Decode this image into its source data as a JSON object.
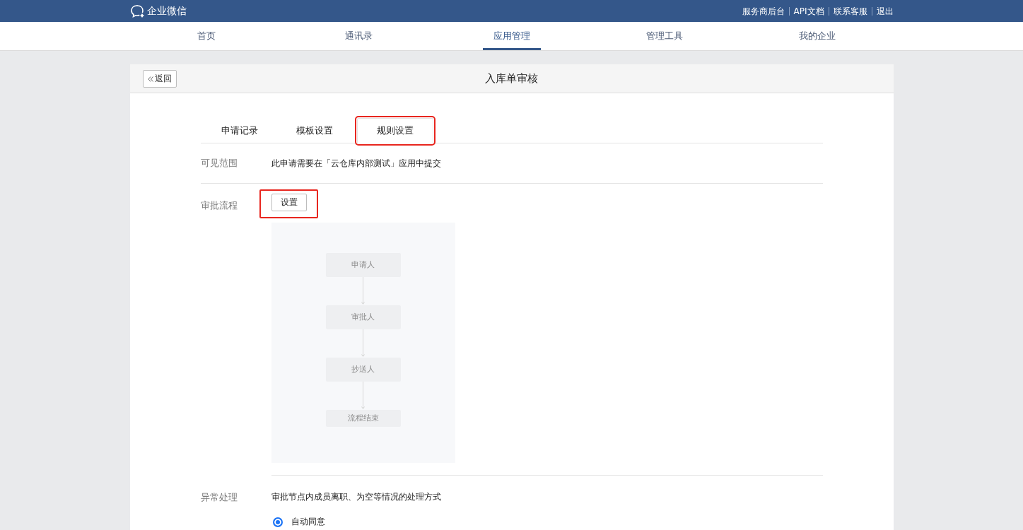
{
  "header": {
    "logo_text": "企业微信",
    "links": [
      "服务商后台",
      "API文档",
      "联系客服",
      "退出"
    ]
  },
  "nav": [
    {
      "label": "首页",
      "selected": false
    },
    {
      "label": "通讯录",
      "selected": false
    },
    {
      "label": "应用管理",
      "selected": true
    },
    {
      "label": "管理工具",
      "selected": false
    },
    {
      "label": "我的企业",
      "selected": false
    }
  ],
  "page": {
    "back_button": "返回",
    "title": "入库单审核"
  },
  "tabs": [
    {
      "label": "申请记录",
      "selected": false,
      "highlighted": false
    },
    {
      "label": "模板设置",
      "selected": false,
      "highlighted": false
    },
    {
      "label": "规则设置",
      "selected": true,
      "highlighted": true
    }
  ],
  "visibility": {
    "label": "可见范围",
    "text": "此申请需要在「云仓库内部测试」应用中提交"
  },
  "approval_flow": {
    "label": "审批流程",
    "button": {
      "label": "设置",
      "highlighted": true
    },
    "nodes": [
      "申请人",
      "审批人",
      "抄送人",
      "流程结束"
    ]
  },
  "exception_handling": {
    "label": "异常处理",
    "description": "审批节点内成员离职、为空等情况的处理方式",
    "options": [
      {
        "label": "自动同意",
        "selected": true
      }
    ]
  }
}
